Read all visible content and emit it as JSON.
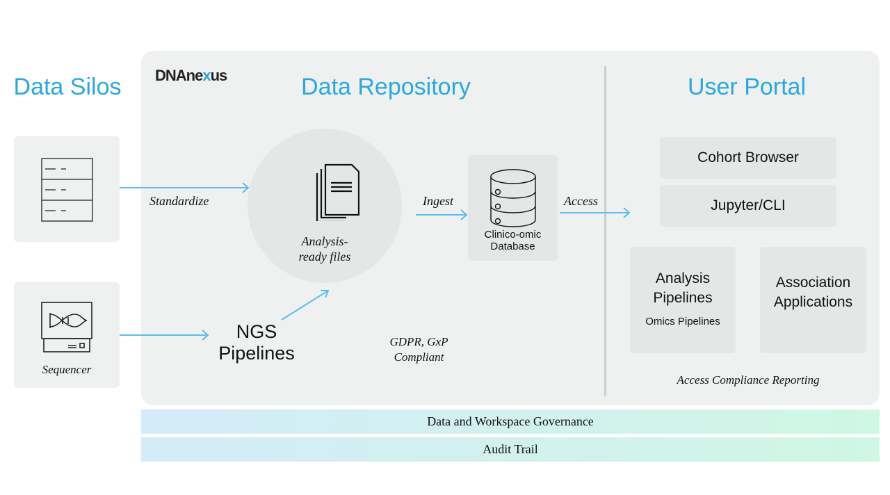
{
  "logo": "DNAnexus",
  "sections": {
    "silos": "Data Silos",
    "repository": "Data Repository",
    "portal": "User Portal"
  },
  "silos": {
    "sequencer": "Sequencer"
  },
  "flow": {
    "standardize": "Standardize",
    "ingest": "Ingest",
    "access": "Access"
  },
  "repository": {
    "files": "Analysis-ready files",
    "ngs": "NGS Pipelines",
    "database": "Clinico-omic Database",
    "compliance": "GDPR, GxP Compliant"
  },
  "portal": {
    "cohort": "Cohort Browser",
    "jupyter": "Jupyter/CLI",
    "analysis": "Analysis Pipelines",
    "analysis_sub": "Omics Pipelines",
    "association": "Association Applications",
    "reporting": "Access Compliance Reporting"
  },
  "bars": [
    "Data and Workspace Governance",
    "Audit Trail"
  ],
  "colors": {
    "accent": "#2ba8e0",
    "arrow": "#5bbcef"
  }
}
